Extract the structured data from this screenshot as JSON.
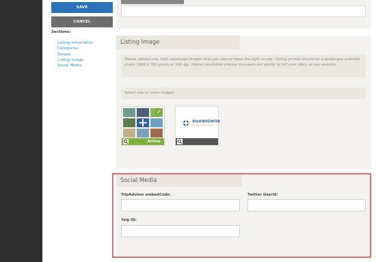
{
  "sidebar": {
    "save_label": "SAVE",
    "cancel_label": "CANCEL",
    "sections_label": "Sections:",
    "items": [
      {
        "label": "Listing Information"
      },
      {
        "label": "Categories"
      },
      {
        "label": "Details"
      },
      {
        "label": "Listing Image"
      },
      {
        "label": "Social Media"
      }
    ]
  },
  "listing_image": {
    "title": "Listing Image",
    "description": "Please upload only high resolution images that you own or have the right to use. Listing photos should be a landscape oriented photo 1900 x 760 pixels at 300 dpi. Higher resolution photos increases our ability to tell your story on our website.",
    "select_label": "Select one or more images",
    "thumbnails": [
      {
        "status": "Active",
        "selected": true
      },
      {
        "logo_text": "VisitWICHITA",
        "logo_sub": "The Heart of the Country",
        "status": ""
      }
    ]
  },
  "social_media": {
    "title": "Social Media",
    "fields": [
      {
        "label": "TripAdvisor embedCode:",
        "value": ""
      },
      {
        "label": "Twitter UserId:",
        "value": ""
      },
      {
        "label": "Yelp ID:",
        "value": ""
      }
    ]
  },
  "colors": {
    "save": "#2a73ba",
    "cancel": "#6d6d6d",
    "link": "#2a8fbf",
    "active": "#7bb03c",
    "highlight": "#e06b73"
  }
}
